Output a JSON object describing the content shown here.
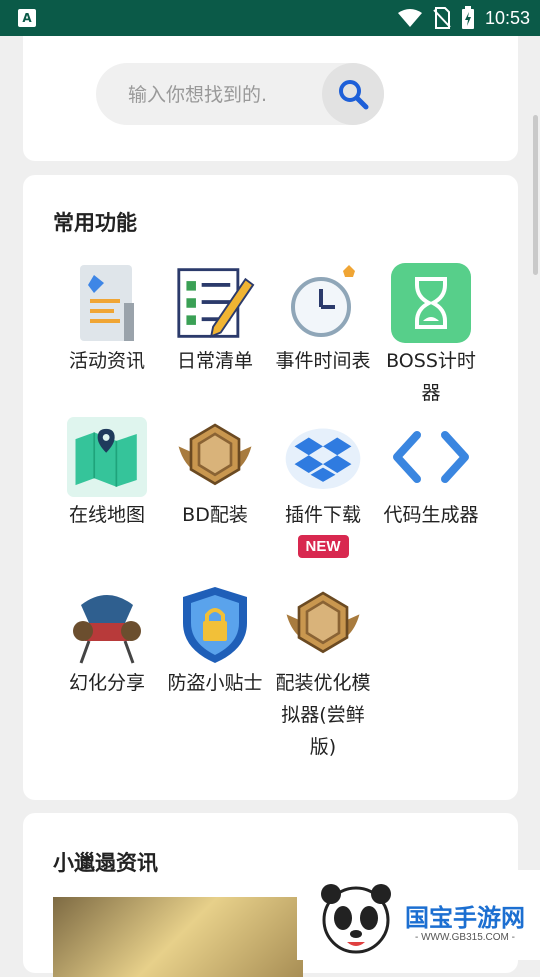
{
  "status_bar": {
    "time": "10:53",
    "app_icon_letter": "A"
  },
  "search": {
    "placeholder": "输入你想找到的."
  },
  "common_functions": {
    "title": "常用功能",
    "items": [
      {
        "label": "活动资讯",
        "icon": "activity-news-icon"
      },
      {
        "label": "日常清单",
        "icon": "daily-checklist-icon"
      },
      {
        "label": "事件时间表",
        "icon": "event-clock-icon"
      },
      {
        "label": "BOSS计时器",
        "icon": "hourglass-icon"
      },
      {
        "label": "在线地图",
        "icon": "map-icon"
      },
      {
        "label": "BD配装",
        "icon": "hexagon-medal-icon"
      },
      {
        "label": "插件下载",
        "icon": "dropbox-icon",
        "badge": "NEW"
      },
      {
        "label": "代码生成器",
        "icon": "code-brackets-icon"
      },
      {
        "label": "幻化分享",
        "icon": "armor-icon"
      },
      {
        "label": "防盗小贴士",
        "icon": "lock-shield-icon"
      },
      {
        "label": "配装优化模拟器(尝鲜版)",
        "icon": "hexagon-medal-icon"
      }
    ]
  },
  "news": {
    "title": "小邋遢资讯"
  },
  "watermark": {
    "brand": "国宝手游网",
    "url": "- WWW.GB315.COM -"
  },
  "colors": {
    "status_bar": "#0b5a48",
    "badge": "#d8284f",
    "search_icon": "#1d5fd8"
  }
}
